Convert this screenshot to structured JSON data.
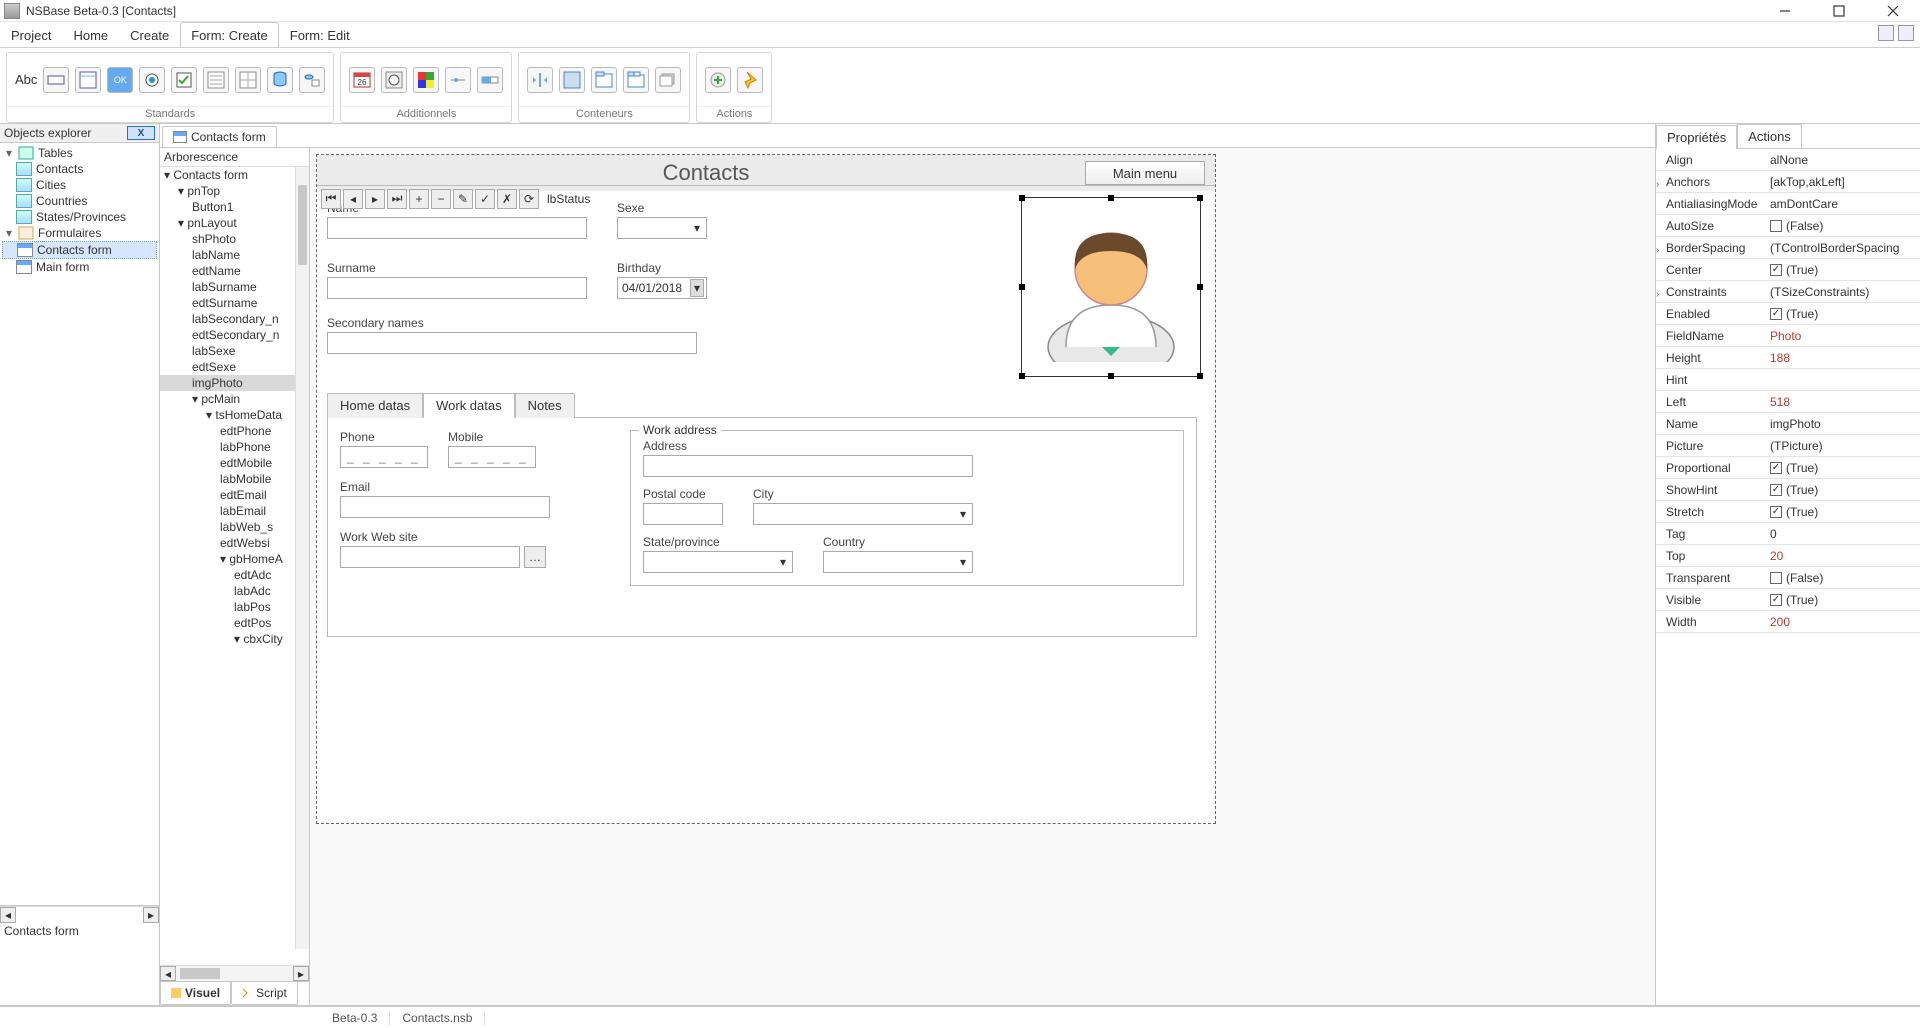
{
  "app": {
    "title": "NSBase Beta-0.3 [Contacts]"
  },
  "menubar": {
    "items": [
      "Project",
      "Home",
      "Create",
      "Form: Create",
      "Form: Edit"
    ],
    "active": 3
  },
  "ribbon": {
    "groups": [
      {
        "label": "Standards"
      },
      {
        "label": "Additionnels"
      },
      {
        "label": "Conteneurs"
      },
      {
        "label": "Actions"
      }
    ]
  },
  "objects_explorer": {
    "title": "Objects explorer",
    "close": "X",
    "tables_label": "Tables",
    "tables": [
      "Contacts",
      "Cities",
      "Countries",
      "States/Provinces"
    ],
    "forms_label": "Formulaires",
    "forms": [
      "Contacts form",
      "Main form"
    ],
    "selected_form": "Contacts form",
    "bottom_label": "Contacts form"
  },
  "doc_tab": "Contacts form",
  "arbor": {
    "title": "Arborescence",
    "nodes": [
      {
        "t": "Contacts form",
        "d": 0,
        "c": "v"
      },
      {
        "t": "pnTop",
        "d": 1,
        "c": "v"
      },
      {
        "t": "Button1",
        "d": 2
      },
      {
        "t": "pnLayout",
        "d": 1,
        "c": "v"
      },
      {
        "t": "shPhoto",
        "d": 2
      },
      {
        "t": "labName",
        "d": 2
      },
      {
        "t": "edtName",
        "d": 2
      },
      {
        "t": "labSurname",
        "d": 2
      },
      {
        "t": "edtSurname",
        "d": 2
      },
      {
        "t": "labSecondary_n",
        "d": 2
      },
      {
        "t": "edtSecondary_n",
        "d": 2
      },
      {
        "t": "labSexe",
        "d": 2
      },
      {
        "t": "edtSexe",
        "d": 2
      },
      {
        "t": "imgPhoto",
        "d": 2,
        "sel": true
      },
      {
        "t": "pcMain",
        "d": 2,
        "c": "v"
      },
      {
        "t": "tsHomeData",
        "d": 3,
        "c": "v"
      },
      {
        "t": "edtPhone",
        "d": 4
      },
      {
        "t": "labPhone",
        "d": 4
      },
      {
        "t": "edtMobile",
        "d": 4
      },
      {
        "t": "labMobile",
        "d": 4
      },
      {
        "t": "edtEmail",
        "d": 4
      },
      {
        "t": "labEmail",
        "d": 4
      },
      {
        "t": "labWeb_s",
        "d": 4
      },
      {
        "t": "edtWebsi",
        "d": 4
      },
      {
        "t": "gbHomeA",
        "d": 4,
        "c": "v"
      },
      {
        "t": "edtAdc",
        "d": 5
      },
      {
        "t": "labAdc",
        "d": 5
      },
      {
        "t": "labPos",
        "d": 5
      },
      {
        "t": "edtPos",
        "d": 5
      },
      {
        "t": "cbxCity",
        "d": 5,
        "c": "v"
      }
    ]
  },
  "view_tabs": {
    "visuel": "Visuel",
    "script": "Script",
    "active": "visuel"
  },
  "form": {
    "title": "Contacts",
    "mainmenu": "Main menu",
    "name": "Name",
    "surname": "Surname",
    "sexe": "Sexe",
    "birthday": "Birthday",
    "birthday_value": "04/01/2018",
    "secondary": "Secondary names",
    "tabs": {
      "home": "Home datas",
      "work": "Work datas",
      "notes": "Notes",
      "active": "work"
    },
    "work": {
      "phone": "Phone",
      "mobile": "Mobile",
      "email": "Email",
      "website": "Work Web site",
      "mask": "__-__-__",
      "group": "Work address",
      "address": "Address",
      "postal": "Postal code",
      "city": "City",
      "state": "State/province",
      "country": "Country"
    },
    "status": "lbStatus"
  },
  "props": {
    "tabs": {
      "p": "Propriétés",
      "a": "Actions"
    },
    "rows": [
      {
        "k": "Align",
        "v": "alNone"
      },
      {
        "k": "Anchors",
        "v": "[akTop,akLeft]",
        "exp": true
      },
      {
        "k": "AntialiasingMode",
        "v": "amDontCare"
      },
      {
        "k": "AutoSize",
        "v": "(False)",
        "chk": false
      },
      {
        "k": "BorderSpacing",
        "v": "(TControlBorderSpacing",
        "exp": true
      },
      {
        "k": "Center",
        "v": "(True)",
        "chk": true
      },
      {
        "k": "Constraints",
        "v": "(TSizeConstraints)",
        "exp": true
      },
      {
        "k": "Enabled",
        "v": "(True)",
        "chk": true
      },
      {
        "k": "FieldName",
        "v": "Photo",
        "num": true
      },
      {
        "k": "Height",
        "v": "188",
        "num": true
      },
      {
        "k": "Hint",
        "v": ""
      },
      {
        "k": "Left",
        "v": "518",
        "num": true
      },
      {
        "k": "Name",
        "v": "imgPhoto"
      },
      {
        "k": "Picture",
        "v": "(TPicture)"
      },
      {
        "k": "Proportional",
        "v": "(True)",
        "chk": true
      },
      {
        "k": "ShowHint",
        "v": "(True)",
        "chk": true
      },
      {
        "k": "Stretch",
        "v": "(True)",
        "chk": true
      },
      {
        "k": "Tag",
        "v": "0"
      },
      {
        "k": "Top",
        "v": "20",
        "num": true
      },
      {
        "k": "Transparent",
        "v": "(False)",
        "chk": false
      },
      {
        "k": "Visible",
        "v": "(True)",
        "chk": true
      },
      {
        "k": "Width",
        "v": "200",
        "num": true
      }
    ]
  },
  "status": {
    "version": "Beta-0.3",
    "file": "Contacts.nsb"
  }
}
